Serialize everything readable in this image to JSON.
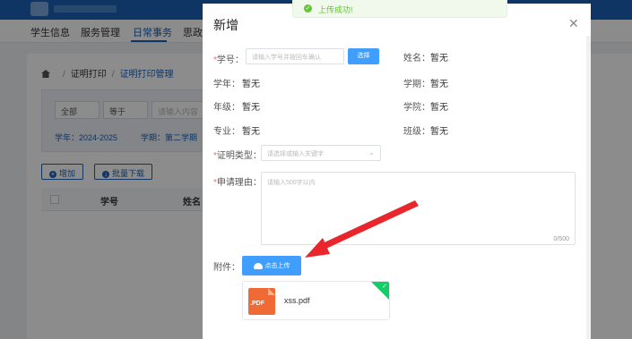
{
  "background": {
    "nav": [
      "学生信息",
      "服务管理",
      "日常事务",
      "思政"
    ],
    "nav_active_index": 2,
    "breadcrumb": [
      "证明打印",
      "证明打印管理"
    ],
    "filter": {
      "field": "全部",
      "op": "等于",
      "placeholder": "请输入内容",
      "year": "学年：2024-2025",
      "term": "学期：第二学期"
    },
    "buttons": {
      "add": "增加",
      "batch_download": "批量下载"
    },
    "table_headers": [
      "学号",
      "姓名"
    ]
  },
  "dialog": {
    "title": "新增",
    "student_id_label": "学号：",
    "student_id_placeholder": "请输入学号并按回车确认",
    "select_button": "选择",
    "name_label": "姓名：",
    "name_value": "暂无",
    "year_label": "学年：",
    "year_value": "暂无",
    "term_label": "学期：",
    "term_value": "暂无",
    "grade_label": "年级：",
    "grade_value": "暂无",
    "college_label": "学院：",
    "college_value": "暂无",
    "major_label": "专业：",
    "major_value": "暂无",
    "class_label": "班级：",
    "class_value": "暂无",
    "cert_type_label": "证明类型：",
    "cert_type_placeholder": "请选择或输入关键字",
    "reason_label": "申请理由：",
    "reason_placeholder": "请输入500字以内",
    "reason_counter": "0/500",
    "attachment_label": "附件：",
    "upload_button": "点击上传",
    "file_name": "xss.pdf",
    "file_type": ".PDF"
  },
  "toast": {
    "message": "上传成功!"
  },
  "colors": {
    "primary": "#409eff",
    "success": "#67c23a",
    "required": "#f56c6c",
    "arrow": "#e8262b"
  }
}
